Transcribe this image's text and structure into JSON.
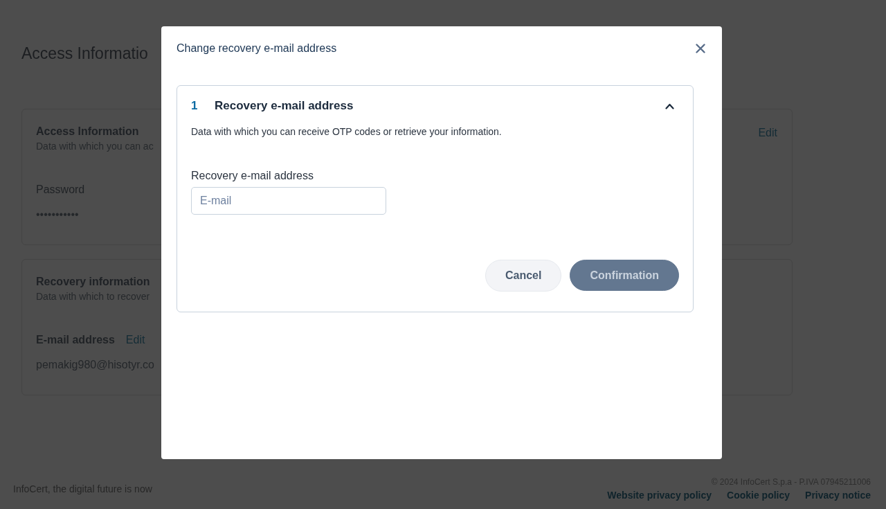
{
  "page": {
    "title": "Access Informatio",
    "sections": [
      {
        "title": "Access Information",
        "description": "Data with which you can ac",
        "action": "Edit",
        "fields": [
          {
            "label": "Password",
            "value": "•••••••••••"
          }
        ]
      },
      {
        "title": "Recovery information",
        "description": "Data with which to recover",
        "fields": [
          {
            "label": "E-mail address",
            "action": "Edit",
            "value": "pemakig980@hisotyr.co"
          }
        ]
      }
    ]
  },
  "footer": {
    "tagline": "InfoCert, the digital future is now",
    "copyright": "© 2024 InfoCert S.p.a - P.IVA 07945211006",
    "links": [
      "Website privacy policy",
      "Cookie policy",
      "Privacy notice"
    ]
  },
  "modal": {
    "title": "Change recovery e-mail address",
    "steps": [
      {
        "number": "1",
        "title": "Recovery e-mail address",
        "expanded": true,
        "description": "Data with which you can receive OTP codes or retrieve your information.",
        "field": {
          "label": "Recovery e-mail address",
          "placeholder": "E-mail"
        },
        "buttons": [
          {
            "label": "Cancel",
            "kind": "secondary",
            "disabled": false
          },
          {
            "label": "Confirmation",
            "kind": "primary",
            "disabled": true
          }
        ]
      }
    ]
  }
}
